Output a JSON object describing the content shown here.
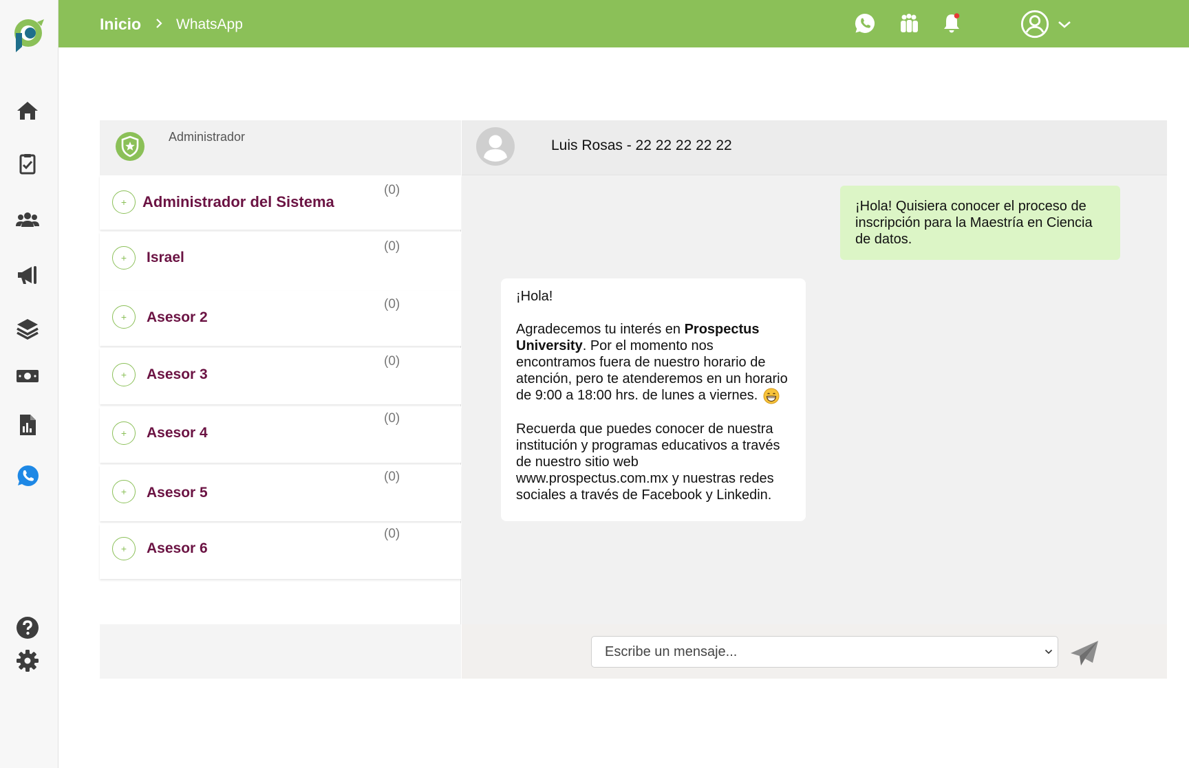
{
  "header": {
    "breadcrumb_home": "Inicio",
    "breadcrumb_current": "WhatsApp"
  },
  "colors": {
    "brand_green": "#8bc058",
    "agent_name": "#6b1343",
    "outgoing_bubble": "#dcf5c6",
    "sidebar_icon": "#3d3d3d",
    "whatsapp_blue": "#1e88e5",
    "notification_dot": "#e53935"
  },
  "sidebar": {
    "icons": [
      "logo-icon",
      "home-icon",
      "clipboard-check-icon",
      "users-icon",
      "megaphone-icon",
      "layers-icon",
      "money-icon",
      "report-icon",
      "whatsapp-icon",
      "help-icon",
      "settings-icon"
    ]
  },
  "left_panel": {
    "role": "Administrador",
    "agents": [
      {
        "name": "Administrador del Sistema",
        "count": "(0)"
      },
      {
        "name": "Israel",
        "count": "(0)"
      },
      {
        "name": "Asesor 2",
        "count": "(0)"
      },
      {
        "name": "Asesor 3",
        "count": "(0)"
      },
      {
        "name": "Asesor 4",
        "count": "(0)"
      },
      {
        "name": "Asesor 5",
        "count": "(0)"
      },
      {
        "name": "Asesor 6",
        "count": "(0)"
      }
    ]
  },
  "chat": {
    "contact": "Luis Rosas - 22 22 22 22 22",
    "outgoing_message": "¡Hola! Quisiera conocer el proceso de inscripción para la Maestría en Ciencia de datos.",
    "incoming": {
      "greeting": "¡Hola!",
      "p1_before": "Agradecemos tu interés en ",
      "p1_bold": "Prospectus University",
      "p1_after": ". Por el momento nos encontramos fuera de nuestro horario de atención, pero te atenderemos en un horario de 9:00 a 18:00 hrs. de lunes a viernes.",
      "p2": "Recuerda que puedes conocer de nuestra institución y programas educativos a través de nuestro sitio web www.prospectus.com.mx y nuestras redes sociales a través de Facebook y Linkedin."
    },
    "select_placeholder": "Escribe un mensaje..."
  }
}
